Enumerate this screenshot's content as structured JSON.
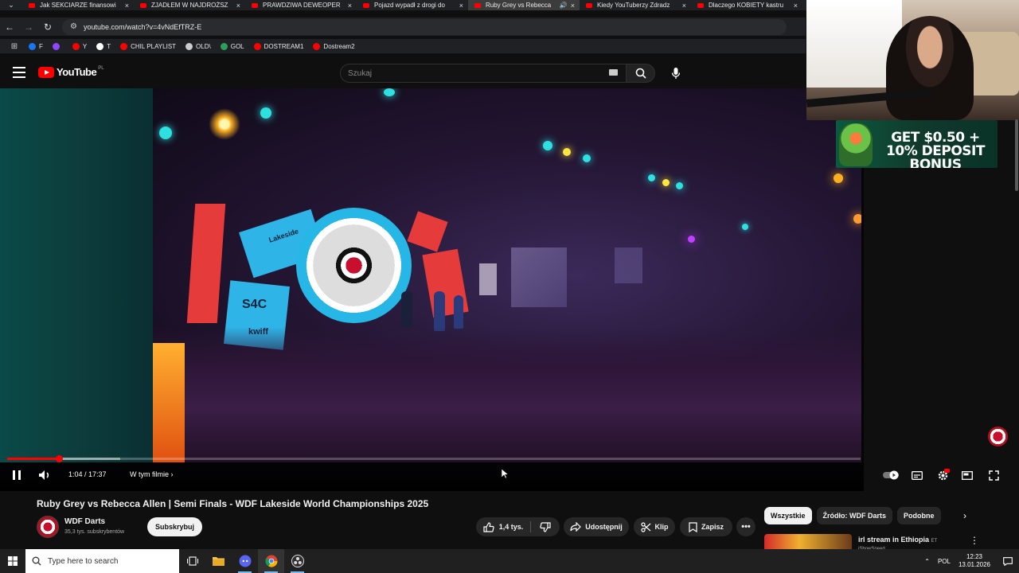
{
  "browser": {
    "tabs": [
      {
        "title": "Jak SEKCIARZE finansowi",
        "active": false
      },
      {
        "title": "ZJADŁEM W NAJDROŻSZ",
        "active": false
      },
      {
        "title": "PRAWDZIWA DEWEOPER",
        "active": false
      },
      {
        "title": "Pojazd wypadł z drogi do",
        "active": false
      },
      {
        "title": "Ruby Grey vs Rebecca",
        "active": true
      },
      {
        "title": "Kiedy YouTuberzy Zdradz",
        "active": false
      },
      {
        "title": "Dlaczego KOBIETY kastru",
        "active": false
      }
    ],
    "url": "youtube.com/watch?v=4vNdEfTRZ-E",
    "bookmarks": [
      {
        "label": "F",
        "icon": "facebook-icon",
        "color": "#1877f2"
      },
      {
        "label": "",
        "icon": "twitch-icon",
        "color": "#9146ff"
      },
      {
        "label": "Y",
        "icon": "youtube-icon",
        "color": "#ff0000"
      },
      {
        "label": "T",
        "icon": "x-icon",
        "color": "#ffffff"
      },
      {
        "label": "CHIL PLAYLIST",
        "icon": "youtube-icon",
        "color": "#ff0000"
      },
      {
        "label": "OLD\\",
        "icon": "folder-icon",
        "color": "#cccccc"
      },
      {
        "label": "GOL",
        "icon": "gol-icon",
        "color": "#2e9e5b"
      },
      {
        "label": "DOSTREAM1",
        "icon": "youtube-icon",
        "color": "#ff0000"
      },
      {
        "label": "Dostream2",
        "icon": "youtube-icon",
        "color": "#ff0000"
      }
    ]
  },
  "youtube": {
    "logo_text": "YouTube",
    "country_code": "PL",
    "search_placeholder": "Szukaj"
  },
  "player": {
    "current_time": "1:04",
    "duration": "17:37",
    "time_display": "1:04 / 17:37",
    "progress_fraction": 0.0606,
    "chapters_label": "W tym filmie",
    "scene_text": {
      "sponsor_1": "S4C",
      "sponsor_2": "kwiff",
      "event_logo": "Lakeside"
    }
  },
  "overlay": {
    "banner_text": "GET $0.50 + 10% DEPOSIT BONUS"
  },
  "video": {
    "title": "Ruby Grey vs Rebecca Allen | Semi Finals - WDF Lakeside World Championships 2025",
    "channel_name": "WDF Darts",
    "subscribers": "35,3 tys. subskrybentów",
    "subscribe_label": "Subskrybuj",
    "likes": "1,4 tys.",
    "share_label": "Udostępnij",
    "clip_label": "Klip",
    "save_label": "Zapisz"
  },
  "sidebar": {
    "chips": [
      {
        "label": "Wszystkie",
        "active": true
      },
      {
        "label": "Źródło: WDF Darts",
        "active": false
      },
      {
        "label": "Podobne",
        "active": false
      }
    ],
    "recommendation": {
      "title": "irl stream in Ethiopia",
      "flag": "ET",
      "channel": "iShowSpeed"
    }
  },
  "taskbar": {
    "search_placeholder": "Type here to search",
    "language": "POL",
    "time": "12:23",
    "date": "13.01.2026"
  },
  "colors": {
    "yt_red": "#ff0000",
    "background": "#0f0f0f",
    "chip_bg": "#272727"
  }
}
